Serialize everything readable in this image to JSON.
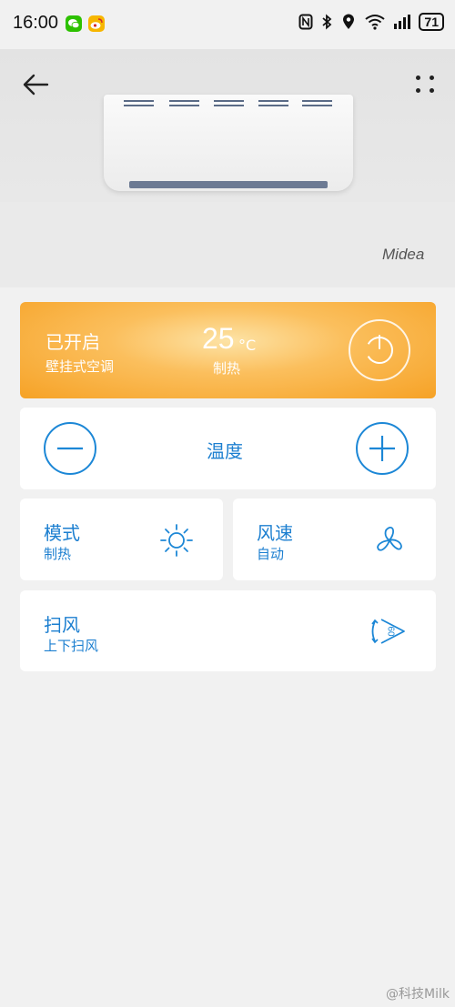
{
  "status_bar": {
    "time": "16:00",
    "battery": "71",
    "apps": [
      "wechat-icon",
      "weibo-icon"
    ],
    "indicators": [
      "nfc-icon",
      "bluetooth-icon",
      "location-icon",
      "wifi-icon",
      "signal-icon"
    ]
  },
  "header": {
    "back_icon": "back-arrow-icon",
    "more_icon": "more-dots-icon"
  },
  "device": {
    "brand": "Midea"
  },
  "power_card": {
    "status": "已开启",
    "type": "壁挂式空调",
    "temperature": "25",
    "unit": "°C",
    "mode": "制热",
    "power_icon": "power-icon",
    "colors": {
      "start": "#fde3a6",
      "end": "#f6a226"
    }
  },
  "temperature_control": {
    "label": "温度",
    "minus_icon": "minus-icon",
    "plus_icon": "plus-icon"
  },
  "mode": {
    "title": "模式",
    "value": "制热",
    "icon": "sun-icon"
  },
  "wind_speed": {
    "title": "风速",
    "value": "自动",
    "icon": "fan-icon"
  },
  "swing": {
    "title": "扫风",
    "value": "上下扫风",
    "icon": "swing-60-icon",
    "icon_text": "60"
  },
  "watermark": "@科技Milk",
  "accent_color": "#1c7fd0"
}
